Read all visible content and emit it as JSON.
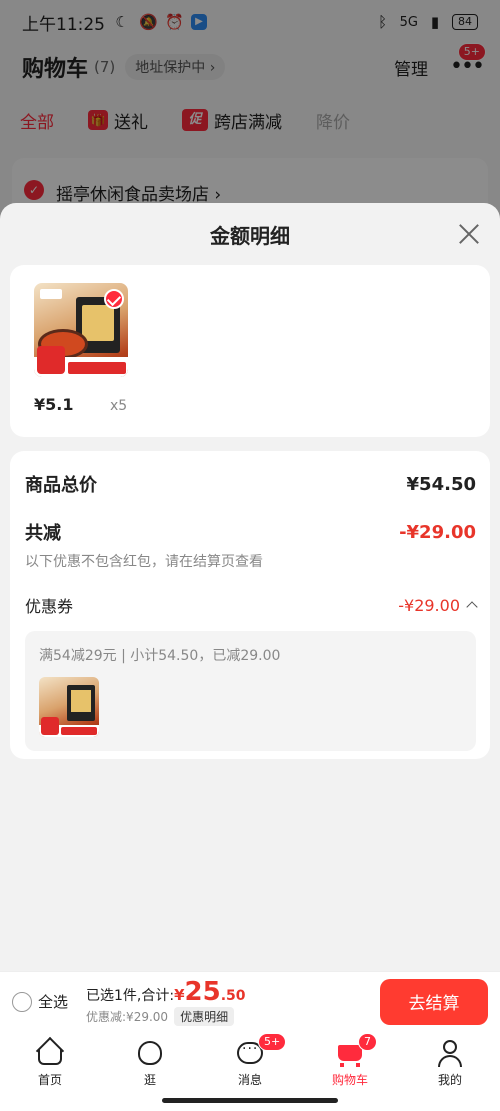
{
  "status_bar": {
    "time": "上午11:25",
    "network": "5G",
    "battery": "84"
  },
  "cart_header": {
    "title": "购物车",
    "count": "(7)",
    "address_protect": "地址保护中 ›",
    "manage": "管理",
    "more_badge": "5+"
  },
  "filter_tabs": [
    {
      "label": "全部"
    },
    {
      "label": "送礼"
    },
    {
      "label": "跨店满减"
    },
    {
      "label": "降价"
    }
  ],
  "promo_tag": "促",
  "shop": {
    "name": "摇亭休闲食品卖场店 ›"
  },
  "sheet": {
    "title": "金额明细",
    "product": {
      "price": "¥5.1",
      "quantity": "x5"
    },
    "total_label": "商品总价",
    "total_value": "¥54.50",
    "reduce_label": "共减",
    "reduce_value": "-¥29.00",
    "note": "以下优惠不包含红包，请在结算页查看",
    "coupon_label": "优惠券",
    "coupon_value": "-¥29.00",
    "coupon_desc": "满54减29元 | 小计54.50，已减29.00"
  },
  "checkout": {
    "select_all": "全选",
    "selected_text": "已选1件,合计:",
    "currency": "¥",
    "amount_int": "25",
    "amount_dec": ".50",
    "discount_text": "优惠减:¥29.00",
    "detail_tag": "优惠明细",
    "checkout_button": "去结算"
  },
  "tab_bar": [
    {
      "label": "首页",
      "icon": "home-icon"
    },
    {
      "label": "逛",
      "icon": "explore-icon"
    },
    {
      "label": "消息",
      "icon": "message-icon",
      "badge": "5+"
    },
    {
      "label": "购物车",
      "icon": "cart-icon",
      "badge": "7",
      "active": true
    },
    {
      "label": "我的",
      "icon": "profile-icon"
    }
  ],
  "colors": {
    "accent": "#ff2b3d",
    "price_red": "#e8352a",
    "checkout_button": "#ff3b30",
    "background": "#f2f2f2"
  }
}
